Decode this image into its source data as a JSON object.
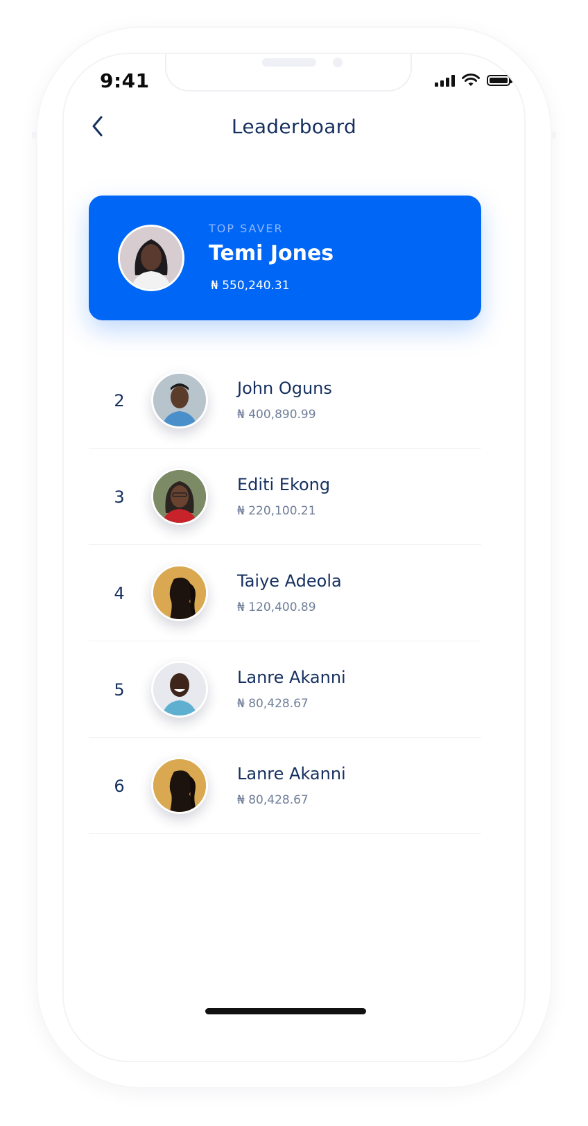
{
  "status_bar": {
    "time": "9:41"
  },
  "header": {
    "title": "Leaderboard"
  },
  "top_saver": {
    "label": "TOP SAVER",
    "name": "Temi Jones",
    "amount": "₦ 550,240.31"
  },
  "leaderboard": [
    {
      "rank": "2",
      "name": "John Oguns",
      "amount": "₦ 400,890.99",
      "avatar_bg": "#b8c4cc"
    },
    {
      "rank": "3",
      "name": "Editi Ekong",
      "amount": "₦ 220,100.21",
      "avatar_bg": "#6f7f5e"
    },
    {
      "rank": "4",
      "name": "Taiye Adeola",
      "amount": "₦ 120,400.89",
      "avatar_bg": "#d9a851"
    },
    {
      "rank": "5",
      "name": "Lanre Akanni",
      "amount": "₦ 80,428.67",
      "avatar_bg": "#e7e9ee"
    },
    {
      "rank": "6",
      "name": "Lanre Akanni",
      "amount": "₦ 80,428.67",
      "avatar_bg": "#d9a851"
    }
  ],
  "colors": {
    "primary": "#0066F5",
    "text_dark": "#16305F",
    "text_muted": "#6F7E99"
  }
}
